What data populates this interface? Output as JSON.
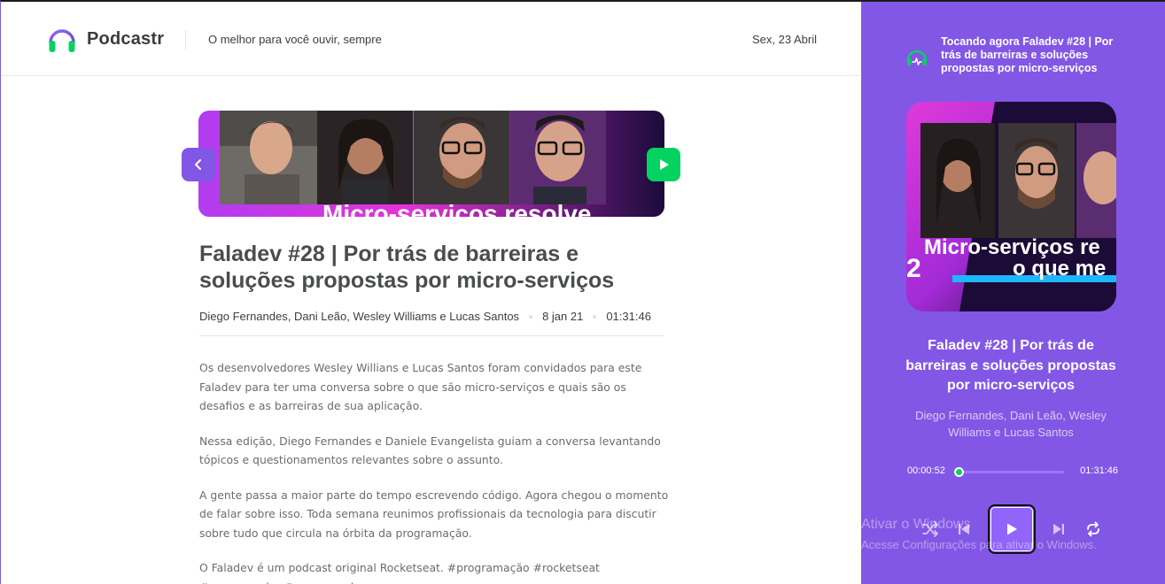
{
  "header": {
    "brand": "Podcastr",
    "tagline": "O melhor para você ouvir, sempre",
    "date": "Sex, 23 Abril"
  },
  "episode": {
    "thumbnail_text": "Micro-servicos resolve",
    "title": "Faladev #28 | Por trás de barreiras e soluções propostas por micro-serviços",
    "members": "Diego Fernandes, Dani Leão, Wesley Williams e Lucas Santos",
    "published": "8 jan 21",
    "duration": "01:31:46",
    "description": [
      "Os desenvolvedores Wesley Willians e Lucas Santos foram convidados para este Faladev para ter uma conversa sobre o que são micro-serviços e quais são os desafios e as barreiras de sua aplicação.",
      "Nessa edição, Diego Fernandes e Daniele Evangelista guiam a conversa levantando tópicos e questionamentos relevantes sobre o assunto.",
      "A gente passa a maior parte do tempo escrevendo código. Agora chegou o momento de falar sobre isso. Toda semana reunimos profissionais da tecnologia para discutir sobre tudo que circula na órbita da programação.",
      "O Faladev é um podcast original Rocketseat. #programação #rocketseat #programador #programador"
    ]
  },
  "player": {
    "now_playing": "Tocando agora Faladev #28 | Por trás de barreiras e soluções propostas por micro-serviços",
    "cover_text_1": "Micro-serviços re",
    "cover_text_2": "o que me",
    "cover_number": "2",
    "title": "Faladev #28 | Por trás de barreiras e soluções propostas por micro-serviços",
    "members": "Diego Fernandes, Dani Leão, Wesley Williams e Lucas Santos",
    "current_time": "00:00:52",
    "total_time": "01:31:46",
    "progress": 0.0095,
    "icons": [
      "shuffle-icon",
      "play-previous-icon",
      "play-icon",
      "play-next-icon",
      "repeat-icon"
    ]
  },
  "watermark": {
    "line1": "Ativar o Windows",
    "line2": "Acesse Configurações para ativar o Windows."
  },
  "colors": {
    "purple": "#8257e5",
    "green": "#04d361",
    "text": "#494d4b"
  }
}
